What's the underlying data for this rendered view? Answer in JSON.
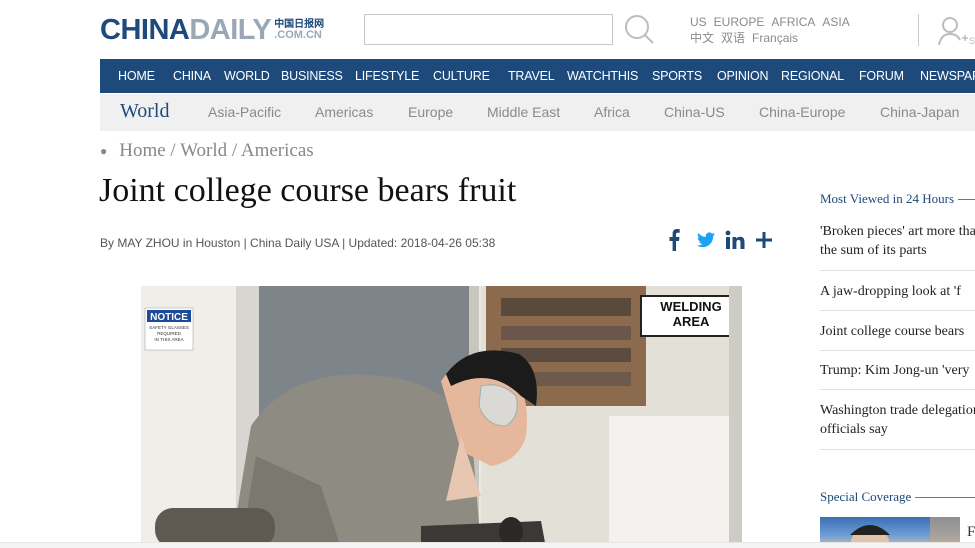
{
  "logo": {
    "part1": "CHINA",
    "part2": "DAILY",
    "cn_text": "中国日报网",
    "domain": ".COM.CN"
  },
  "languages": {
    "row1": [
      "US",
      "EUROPE",
      "AFRICA",
      "ASIA"
    ],
    "row2": [
      "中文",
      "双语",
      "Français"
    ]
  },
  "main_nav": [
    "HOME",
    "CHINA",
    "WORLD",
    "BUSINESS",
    "LIFESTYLE",
    "CULTURE",
    "TRAVEL",
    "WATCHTHIS",
    "SPORTS",
    "OPINION",
    "REGIONAL",
    "FORUM",
    "NEWSPAP"
  ],
  "sub_nav": {
    "title": "World",
    "items": [
      "Asia-Pacific",
      "Americas",
      "Europe",
      "Middle East",
      "Africa",
      "China-US",
      "China-Europe",
      "China-Japan"
    ]
  },
  "breadcrumb": "Home / World / Americas",
  "article": {
    "headline": "Joint college course bears fruit",
    "byline": "By MAY ZHOU in Houston | China Daily USA | Updated: 2018-04-26 05:38"
  },
  "photo": {
    "notice_title": "NOTICE",
    "notice_text": "SAFETY GLASSES REQUIRED IN THIS AREA",
    "sign_text": "WELDING AREA"
  },
  "sidebar": {
    "most_viewed_title": "Most Viewed in 24 Hours",
    "most_viewed": [
      "'Broken pieces' art more than the sum of its parts",
      "A jaw-dropping look at 'f",
      "Joint college course bears",
      "Trump: Kim Jong-un 'very",
      "Washington trade delegation officials say"
    ],
    "special_coverage_title": "Special Coverage",
    "special_letter": "F"
  },
  "colors": {
    "brand_blue": "#1d4a7a",
    "logo_gray": "#9aa7b5",
    "twitter_blue": "#1da1f2"
  }
}
